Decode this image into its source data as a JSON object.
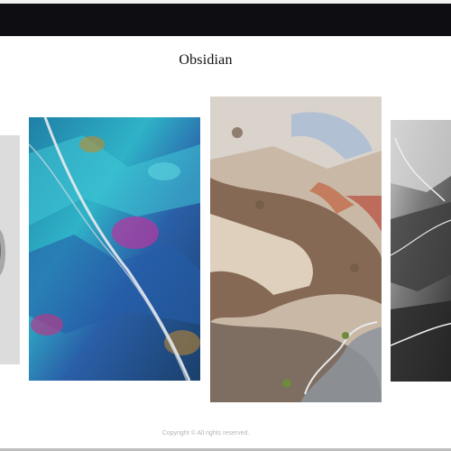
{
  "header": {
    "title": "Obsidian"
  },
  "gallery": {
    "images": [
      {
        "name": "grey-mineral",
        "description": ""
      },
      {
        "name": "iridescent-ore"
      },
      {
        "name": "aerial-desert"
      },
      {
        "name": "black-ice"
      }
    ]
  },
  "footer": {
    "copyright": "Copyright © All rights reserved."
  },
  "colors": {
    "topbar": "#0e0e12",
    "background": "#ffffff",
    "title": "#111111",
    "footer_text": "#b5b5b5"
  }
}
